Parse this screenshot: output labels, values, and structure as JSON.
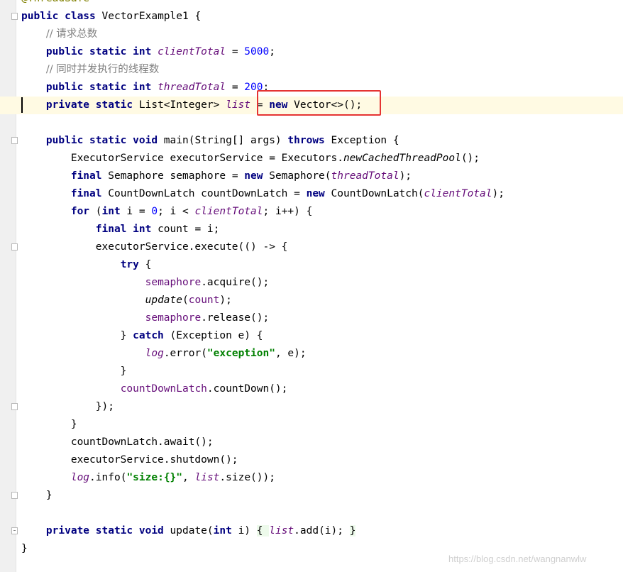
{
  "lines": [
    {
      "id": "l0",
      "parts": [
        [
          "ann",
          "@ThreadSafe"
        ]
      ]
    },
    {
      "id": "l1",
      "parts": [
        [
          "kw",
          "public class "
        ],
        [
          "",
          "VectorExample1 {"
        ]
      ]
    },
    {
      "id": "l2",
      "parts": [
        [
          "",
          "    "
        ],
        [
          "cm",
          "// 请求总数"
        ]
      ]
    },
    {
      "id": "l3",
      "parts": [
        [
          "",
          "    "
        ],
        [
          "kw",
          "public static int "
        ],
        [
          "fld",
          "clientTotal"
        ],
        [
          "",
          " = "
        ],
        [
          "num",
          "5000"
        ],
        [
          "",
          ";"
        ]
      ]
    },
    {
      "id": "l4",
      "parts": [
        [
          "",
          "    "
        ],
        [
          "cm",
          "// 同时并发执行的线程数"
        ]
      ]
    },
    {
      "id": "l5",
      "parts": [
        [
          "",
          "    "
        ],
        [
          "kw",
          "public static int "
        ],
        [
          "fld",
          "threadTotal"
        ],
        [
          "",
          " = "
        ],
        [
          "num",
          "200"
        ],
        [
          "",
          ";"
        ]
      ]
    },
    {
      "id": "l6",
      "parts": [
        [
          "",
          "    "
        ],
        [
          "kw",
          "private static "
        ],
        [
          "",
          "List<Integer> "
        ],
        [
          "fld",
          "list"
        ],
        [
          "",
          " = "
        ],
        [
          "kw",
          "new "
        ],
        [
          "",
          "Vector<>();"
        ]
      ]
    },
    {
      "id": "l7",
      "parts": []
    },
    {
      "id": "l8",
      "parts": [
        [
          "",
          "    "
        ],
        [
          "kw",
          "public static void "
        ],
        [
          "",
          "main(String[] args) "
        ],
        [
          "kw",
          "throws "
        ],
        [
          "",
          "Exception {"
        ]
      ]
    },
    {
      "id": "l9",
      "parts": [
        [
          "",
          "        ExecutorService executorService = Executors."
        ],
        [
          "mth",
          "newCachedThreadPool"
        ],
        [
          "",
          "();"
        ]
      ]
    },
    {
      "id": "l10",
      "parts": [
        [
          "",
          "        "
        ],
        [
          "kw",
          "final "
        ],
        [
          "",
          "Semaphore semaphore = "
        ],
        [
          "kw",
          "new "
        ],
        [
          "",
          "Semaphore("
        ],
        [
          "fld",
          "threadTotal"
        ],
        [
          "",
          ");"
        ]
      ]
    },
    {
      "id": "l11",
      "parts": [
        [
          "",
          "        "
        ],
        [
          "kw",
          "final "
        ],
        [
          "",
          "CountDownLatch countDownLatch = "
        ],
        [
          "kw",
          "new "
        ],
        [
          "",
          "CountDownLatch("
        ],
        [
          "fld",
          "clientTotal"
        ],
        [
          "",
          ");"
        ]
      ]
    },
    {
      "id": "l12",
      "parts": [
        [
          "",
          "        "
        ],
        [
          "kw",
          "for "
        ],
        [
          "",
          "("
        ],
        [
          "kw",
          "int "
        ],
        [
          "",
          "i = "
        ],
        [
          "num",
          "0"
        ],
        [
          "",
          "; i < "
        ],
        [
          "fld",
          "clientTotal"
        ],
        [
          "",
          "; i++) {"
        ]
      ]
    },
    {
      "id": "l13",
      "parts": [
        [
          "",
          "            "
        ],
        [
          "kw",
          "final int "
        ],
        [
          "",
          "count = i;"
        ]
      ]
    },
    {
      "id": "l14",
      "parts": [
        [
          "",
          "            executorService.execute(() -> {"
        ]
      ]
    },
    {
      "id": "l15",
      "parts": [
        [
          "",
          "                "
        ],
        [
          "kw",
          "try "
        ],
        [
          "",
          "{"
        ]
      ]
    },
    {
      "id": "l16",
      "parts": [
        [
          "",
          "                    "
        ],
        [
          "fldp",
          "semaphore"
        ],
        [
          "",
          ".acquire();"
        ]
      ]
    },
    {
      "id": "l17",
      "parts": [
        [
          "",
          "                    "
        ],
        [
          "mth",
          "update"
        ],
        [
          "",
          "("
        ],
        [
          "fldp",
          "count"
        ],
        [
          "",
          ");"
        ]
      ]
    },
    {
      "id": "l18",
      "parts": [
        [
          "",
          "                    "
        ],
        [
          "fldp",
          "semaphore"
        ],
        [
          "",
          ".release();"
        ]
      ]
    },
    {
      "id": "l19",
      "parts": [
        [
          "",
          "                } "
        ],
        [
          "kw",
          "catch "
        ],
        [
          "",
          "(Exception e) {"
        ]
      ]
    },
    {
      "id": "l20",
      "parts": [
        [
          "",
          "                    "
        ],
        [
          "fld",
          "log"
        ],
        [
          "",
          ".error("
        ],
        [
          "str",
          "\"exception\""
        ],
        [
          "",
          ", e);"
        ]
      ]
    },
    {
      "id": "l21",
      "parts": [
        [
          "",
          "                }"
        ]
      ]
    },
    {
      "id": "l22",
      "parts": [
        [
          "",
          "                "
        ],
        [
          "fldp",
          "countDownLatch"
        ],
        [
          "",
          ".countDown();"
        ]
      ]
    },
    {
      "id": "l23",
      "parts": [
        [
          "",
          "            });"
        ]
      ]
    },
    {
      "id": "l24",
      "parts": [
        [
          "",
          "        }"
        ]
      ]
    },
    {
      "id": "l25",
      "parts": [
        [
          "",
          "        countDownLatch.await();"
        ]
      ]
    },
    {
      "id": "l26",
      "parts": [
        [
          "",
          "        executorService.shutdown();"
        ]
      ]
    },
    {
      "id": "l27",
      "parts": [
        [
          "",
          "        "
        ],
        [
          "fld",
          "log"
        ],
        [
          "",
          ".info("
        ],
        [
          "str",
          "\"size:{}\""
        ],
        [
          "",
          ", "
        ],
        [
          "fld",
          "list"
        ],
        [
          "",
          ".size());"
        ]
      ]
    },
    {
      "id": "l28",
      "parts": [
        [
          "",
          "    }"
        ]
      ]
    },
    {
      "id": "l29",
      "parts": []
    },
    {
      "id": "l30",
      "parts": [
        [
          "",
          "    "
        ],
        [
          "kw",
          "private static void "
        ],
        [
          "",
          "update("
        ],
        [
          "kw",
          "int "
        ],
        [
          "",
          "i) "
        ],
        [
          "lam",
          "{ "
        ],
        [
          "fld",
          "list"
        ],
        [
          "",
          ".add(i); "
        ],
        [
          "lam",
          "}"
        ]
      ]
    },
    {
      "id": "l31",
      "parts": [
        [
          "",
          "}"
        ]
      ]
    }
  ],
  "current_line_index": 6,
  "watermark": "https://blog.csdn.net/wangnanwlw"
}
